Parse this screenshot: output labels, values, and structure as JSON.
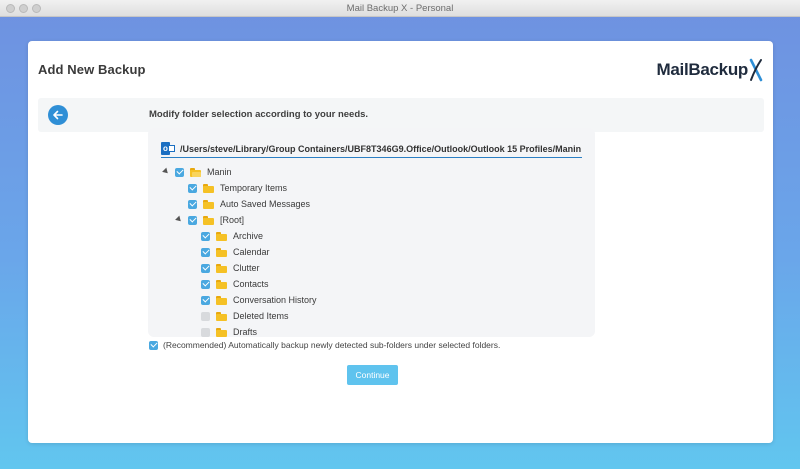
{
  "window": {
    "title": "Mail Backup X - Personal"
  },
  "page": {
    "title": "Add New Backup"
  },
  "logo": {
    "text": "MailBackup"
  },
  "instruction": "Modify folder selection according to your needs.",
  "tree": {
    "path": "/Users/steve/Library/Group Containers/UBF8T346G9.Office/Outlook/Outlook 15 Profiles/Manin",
    "items": [
      {
        "label": "Manin",
        "checked": true,
        "expanded": true
      },
      {
        "label": "Temporary Items",
        "checked": true
      },
      {
        "label": "Auto Saved Messages",
        "checked": true
      },
      {
        "label": "[Root]",
        "checked": true,
        "expanded": true
      },
      {
        "label": "Archive",
        "checked": true
      },
      {
        "label": "Calendar",
        "checked": true
      },
      {
        "label": "Clutter",
        "checked": true
      },
      {
        "label": "Contacts",
        "checked": true
      },
      {
        "label": "Conversation History",
        "checked": true
      },
      {
        "label": "Deleted Items",
        "checked": false
      },
      {
        "label": "Drafts",
        "checked": false
      }
    ]
  },
  "recommend": {
    "checked": true,
    "label": "(Recommended) Automatically backup newly detected sub-folders under selected folders."
  },
  "buttons": {
    "continue": "Continue"
  },
  "colors": {
    "accent": "#2f8fd6",
    "checkbox": "#4aa8e0",
    "button": "#5fc3ee"
  }
}
